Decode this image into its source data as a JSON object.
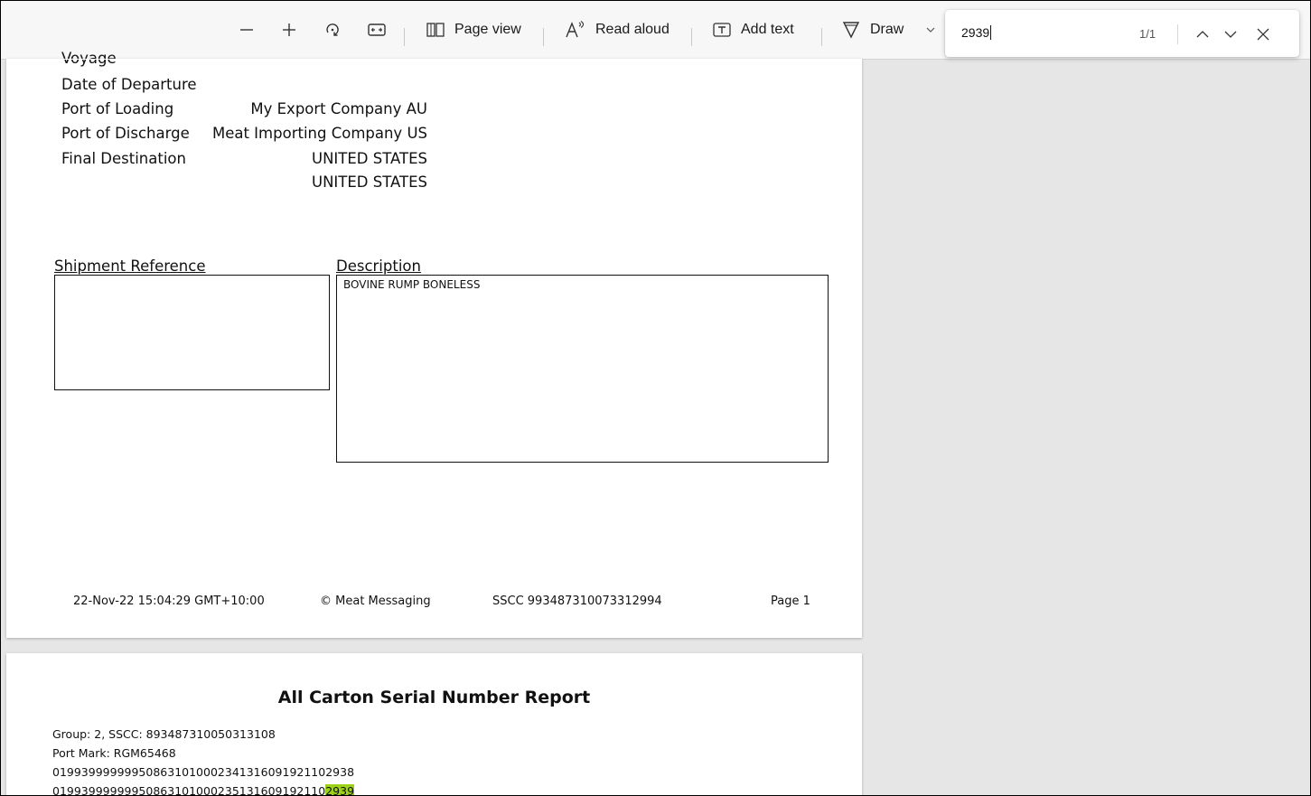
{
  "toolbar": {
    "page_view_label": "Page view",
    "read_aloud_label": "Read aloud",
    "add_text_label": "Add text",
    "draw_label": "Draw",
    "icons": [
      "minus-icon",
      "plus-icon",
      "rotate-icon",
      "fit-width-icon",
      "page-view-icon",
      "read-aloud-icon",
      "add-text-icon",
      "draw-icon",
      "chevron-down-icon"
    ]
  },
  "find": {
    "query": "2939",
    "count": "1/1",
    "icons": [
      "previous-match-icon",
      "next-match-icon",
      "close-icon"
    ]
  },
  "page1": {
    "partial_label": "Voyage",
    "fields": [
      {
        "label": "Date of Departure",
        "value": ""
      },
      {
        "label": "Port of Loading",
        "value": "My Export Company AU"
      },
      {
        "label": "Port of Discharge",
        "value": "Meat Importing Company US"
      },
      {
        "label": "Final Destination",
        "value": "UNITED STATES"
      }
    ],
    "extra_value": "UNITED STATES",
    "shipment_reference_title": "Shipment Reference",
    "shipment_reference_text": "",
    "description_title": "Description",
    "description_text": "BOVINE RUMP BONELESS",
    "footer": {
      "timestamp": "22-Nov-22 15:04:29 GMT+10:00",
      "copyright": "© Meat Messaging",
      "sscc": "SSCC 993487310073312994",
      "page": "Page 1"
    }
  },
  "page2": {
    "title": "All Carton Serial Number Report",
    "group_line": "Group: 2, SSCC: 893487310050313108",
    "port_mark_line": "Port Mark: RGM65468",
    "serial_line_1": "019939999999508631010002341316091921102938",
    "serial_line_2_prefix": "01993999999950863101000235131609192110",
    "serial_line_2_match": "2939"
  },
  "colors": {
    "find_highlight": "#9ed11a",
    "viewer_background": "#e6e6e6"
  }
}
